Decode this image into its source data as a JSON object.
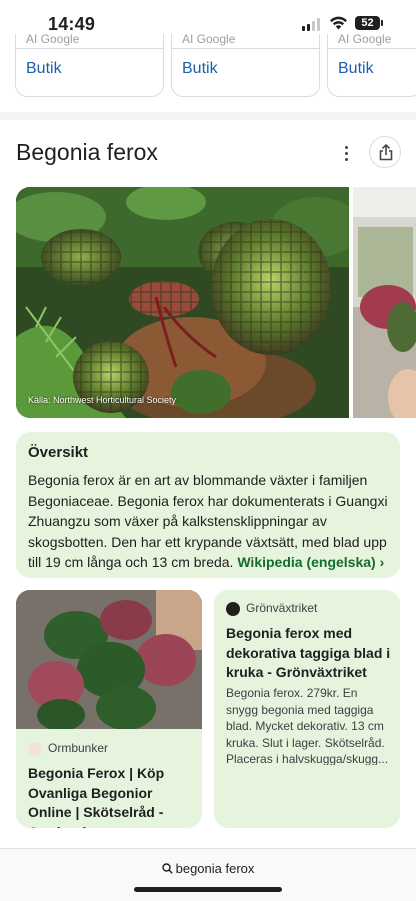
{
  "status_bar": {
    "time": "14:49",
    "battery": "52"
  },
  "shop_cards": [
    {
      "cut_text": "AI Google",
      "label": "Butik"
    },
    {
      "cut_text": "AI Google",
      "label": "Butik"
    },
    {
      "cut_text": "AI Google",
      "label": "Butik"
    }
  ],
  "knowledge_panel": {
    "title": "Begonia ferox",
    "image_caption": "Källa: Northwest Horticultural Society"
  },
  "overview": {
    "heading": "Översikt",
    "text": "Begonia ferox är en art av blommande växter i familjen Begoniaceae. Begonia ferox har dokumenterats i Guangxi Zhuangzu som växer på kalkstensklippningar av skogsbotten. Den har ett krypande växtsätt, med blad upp till 19 cm långa och 13 cm breda.",
    "link": "Wikipedia (engelska) ›"
  },
  "results": [
    {
      "source": "Ormbunker",
      "title": "Begonia Ferox | Köp Ovanliga Begonior Online | Skötselråd - Ormbunker"
    },
    {
      "source": "Grönväxtriket",
      "title": "Begonia ferox med dekorativa taggiga blad i kruka - Grönväxtriket",
      "snippet": "Begonia ferox. 279kr. En snygg begonia med taggiga blad. Mycket dekorativ. 13 cm kruka. Slut i lager. Skötselråd. Placeras i halvskugga/skugg..."
    }
  ],
  "bottom_bar": {
    "query": "begonia ferox"
  },
  "colors": {
    "accent_green_bg": "#e6f4de",
    "link_blue": "#1a5fb4",
    "wiki_green": "#146c2e"
  }
}
